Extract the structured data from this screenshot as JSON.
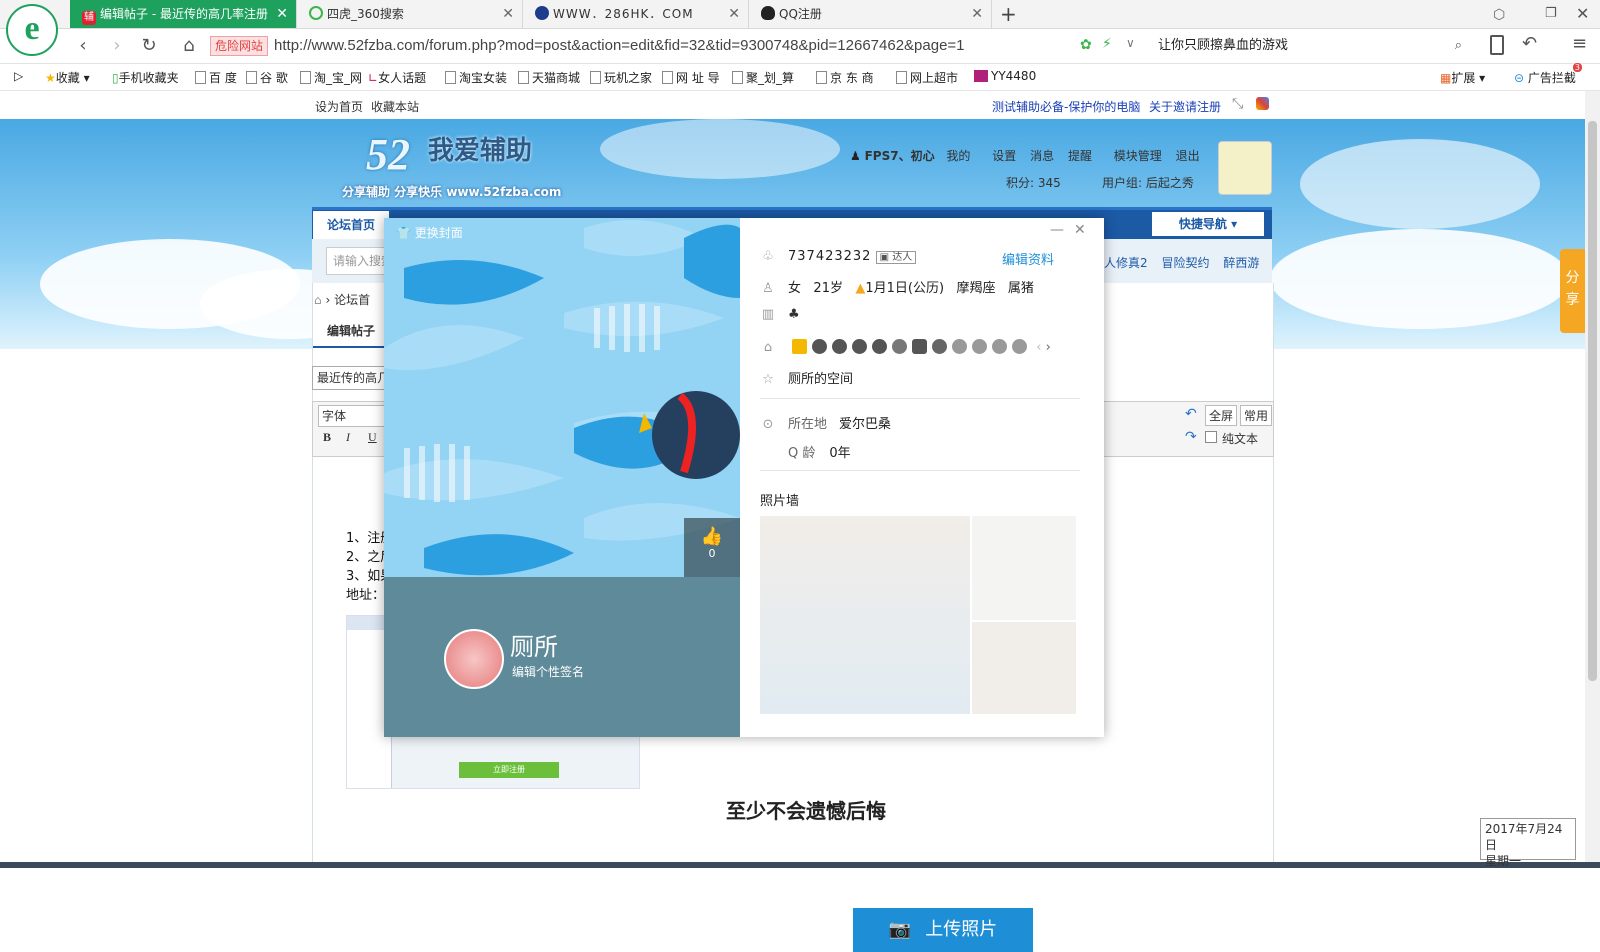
{
  "browser": {
    "tabs": [
      {
        "label": "编辑帖子 - 最近传的高几率注册",
        "icon": "辅",
        "active": true
      },
      {
        "label": "四虎_360搜索",
        "icon": "",
        "active": false
      },
      {
        "label": "WWW．286HK．COM",
        "icon": "",
        "active": false
      },
      {
        "label": "QQ注册",
        "icon": "",
        "active": false
      }
    ],
    "new_tab": "+",
    "danger_label": "危险网站",
    "url": "http://www.52fzba.com/forum.php?mod=post&action=edit&fid=32&tid=9300748&pid=12667462&page=1",
    "search_text": "让你只顾擦鼻血的游戏",
    "bookmarks": [
      "收藏",
      "手机收藏夹",
      "百 度",
      "谷 歌",
      "淘_宝_网",
      "女人话题",
      "淘宝女装",
      "天猫商城",
      "玩机之家",
      "网 址 导",
      "聚_划_算",
      "京 东 商",
      "网上超市",
      "YY4480"
    ],
    "ext_label": "扩展",
    "adblock_label": "广告拦截",
    "adblock_count": "3"
  },
  "site": {
    "top_links": [
      "设为首页",
      "收藏本站"
    ],
    "top_right_links": [
      "测试辅助必备-保护你的电脑",
      "关于邀请注册"
    ],
    "logo_number": "52",
    "logo_title": "我爱辅助",
    "logo_sub": "分享辅助  分享快乐  www.52fzba.com",
    "user_name": "FPS7、初心",
    "user_links": [
      "我的",
      "设置",
      "消息",
      "提醒",
      "模块管理",
      "退出"
    ],
    "points": "积分: 345",
    "user_group": "用户组: 后起之秀",
    "nav_home": "论坛首页",
    "quick_nav": "快捷导航",
    "search_placeholder": "请输入搜索",
    "side_links": [
      "人修真2",
      "冒险契约",
      "醉西游"
    ],
    "breadcrumb": "论坛首",
    "edit_tab": "编辑帖子",
    "subject": "最近传的高几",
    "font_label": "字体",
    "editor_buttons": [
      "全屏",
      "常用"
    ],
    "plain_text": "纯文本",
    "content_lines": [
      "1、注册",
      "2、之后",
      "3、如果",
      "地址："
    ],
    "register_btn": "立即注册",
    "footer_text": "至少不会遗憾后悔",
    "share": "分享"
  },
  "profile": {
    "cover_btn": "更换封面",
    "like_count": "0",
    "nickname": "厕所",
    "signature_placeholder": "编辑个性签名",
    "qq": "737423232",
    "expert_tag": "达人",
    "edit_profile": "编辑资料",
    "gender": "女",
    "age": "21岁",
    "birthday": "1月1日(公历)",
    "zodiac": "摩羯座",
    "chinese_zodiac": "属猪",
    "space": "厕所的空间",
    "location_label": "所在地",
    "location": "爱尔巴桑",
    "qage_label": "Q 龄",
    "qage": "0年",
    "photo_wall": "照片墙",
    "upload_btn": "上传照片"
  },
  "taskbar": {
    "date": "2017年7月24日",
    "weekday": "星期一"
  }
}
